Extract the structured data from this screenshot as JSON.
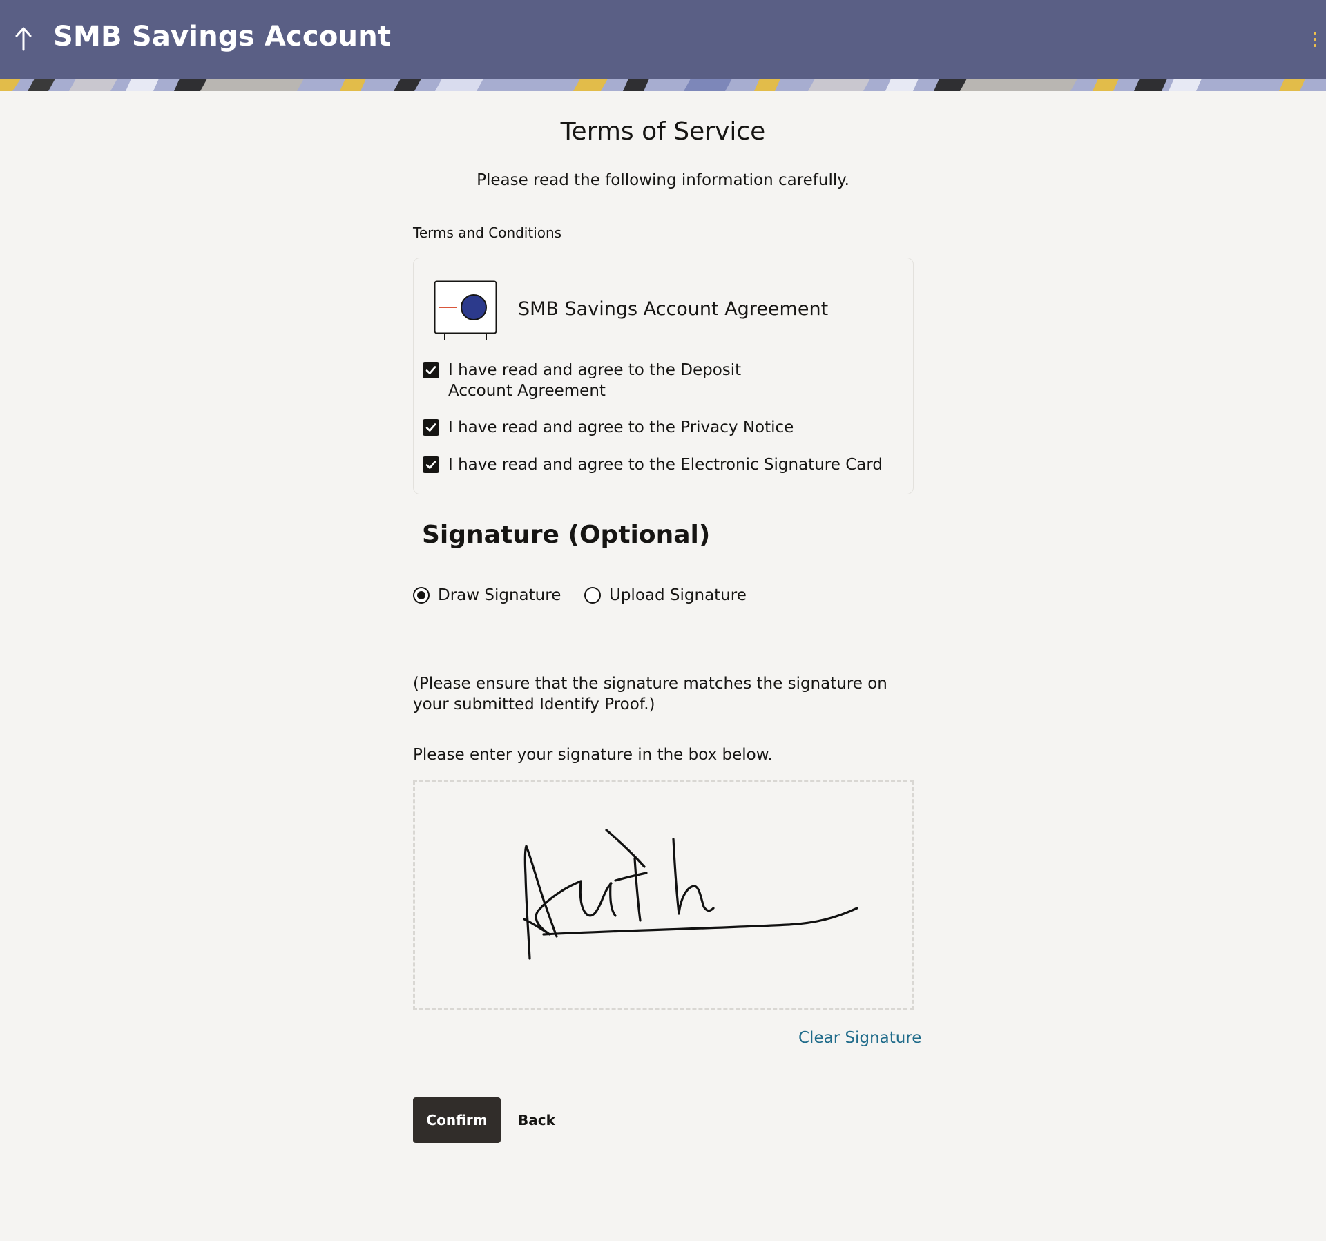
{
  "header": {
    "title": "SMB Savings Account",
    "back_icon": "up-arrow-icon",
    "menu_icon": "kebab-menu-icon",
    "background": "#5a5f85"
  },
  "page": {
    "heading": "Terms of Service",
    "intro": "Please read the following information carefully.",
    "section_label": "Terms and Conditions"
  },
  "terms": {
    "document_icon": "document-icon",
    "document_title": "SMB Savings Account Agreement",
    "checkboxes": [
      {
        "label": "I have read and agree to the Deposit Account Agreement",
        "checked": true
      },
      {
        "label": "I have read and agree to the Privacy Notice",
        "checked": true
      },
      {
        "label": "I have read and agree to the Electronic Signature Card",
        "checked": true
      }
    ]
  },
  "signature": {
    "title": "Signature (Optional)",
    "options": [
      {
        "label": "Draw Signature",
        "selected": true
      },
      {
        "label": "Upload Signature",
        "selected": false
      }
    ],
    "note": "(Please ensure that the signature matches the signature on your submitted Identify Proof.)",
    "prompt": "Please enter your signature in the box below.",
    "clear_label": "Clear Signature",
    "link_color": "#1f6b8a"
  },
  "actions": {
    "confirm_label": "Confirm",
    "back_label": "Back",
    "confirm_color": "#312d2a"
  }
}
